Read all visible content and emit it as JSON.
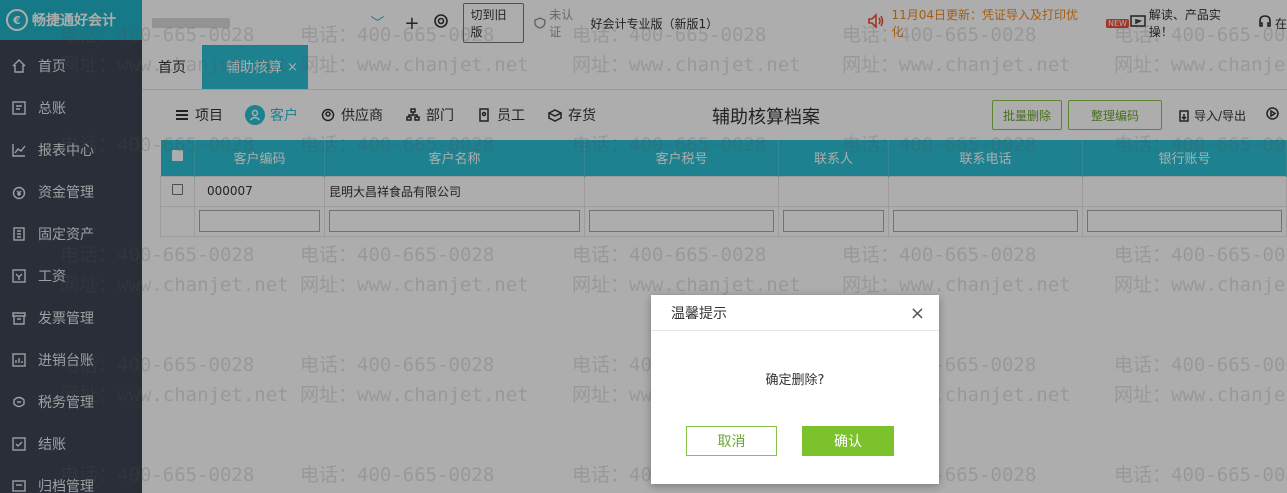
{
  "app": {
    "logo_text": "畅捷通好会计",
    "logo_mark": "€"
  },
  "sidebar": {
    "items": [
      {
        "label": "首页",
        "icon": "home-icon"
      },
      {
        "label": "总账",
        "icon": "ledger-icon"
      },
      {
        "label": "报表中心",
        "icon": "chart-icon"
      },
      {
        "label": "资金管理",
        "icon": "money-icon"
      },
      {
        "label": "固定资产",
        "icon": "asset-icon"
      },
      {
        "label": "工资",
        "icon": "salary-icon"
      },
      {
        "label": "发票管理",
        "icon": "invoice-icon"
      },
      {
        "label": "进销台账",
        "icon": "inventory-icon"
      },
      {
        "label": "税务管理",
        "icon": "tax-icon"
      },
      {
        "label": "结账",
        "icon": "close-book-icon"
      },
      {
        "label": "归档管理",
        "icon": "archive-icon"
      }
    ]
  },
  "topbar": {
    "switch_label": "切到旧版",
    "cert_label": "未认证",
    "product_label": "好会计专业版（新版1）",
    "notice": "11月04日更新：凭证导入及打印优化",
    "new_badge": "NEW",
    "interpret_label": "解读、产品实操！",
    "online_label": "在"
  },
  "tabs": [
    {
      "label": "首页"
    },
    {
      "label": "辅助核算",
      "close": "×"
    }
  ],
  "subtabs": [
    {
      "label": "项目"
    },
    {
      "label": "客户"
    },
    {
      "label": "供应商"
    },
    {
      "label": "部门"
    },
    {
      "label": "员工"
    },
    {
      "label": "存货"
    }
  ],
  "page_heading": "辅助核算档案",
  "actions": {
    "batch_delete": "批量删除",
    "organize_code": "整理编码",
    "import_export": "导入/导出"
  },
  "table": {
    "columns": [
      "客户编码",
      "客户名称",
      "客户税号",
      "联系人",
      "联系电话",
      "银行账号"
    ],
    "rows": [
      {
        "code": "000007",
        "name": "昆明大昌祥食品有限公司",
        "tax": "",
        "contact": "",
        "phone": "",
        "bank": ""
      }
    ]
  },
  "watermark": {
    "phone": "电话：400-665-0028",
    "site": "网址：www.chanjet.net"
  },
  "dialog": {
    "title": "温馨提示",
    "close": "×",
    "message": "确定删除?",
    "cancel": "取消",
    "ok": "确认"
  }
}
